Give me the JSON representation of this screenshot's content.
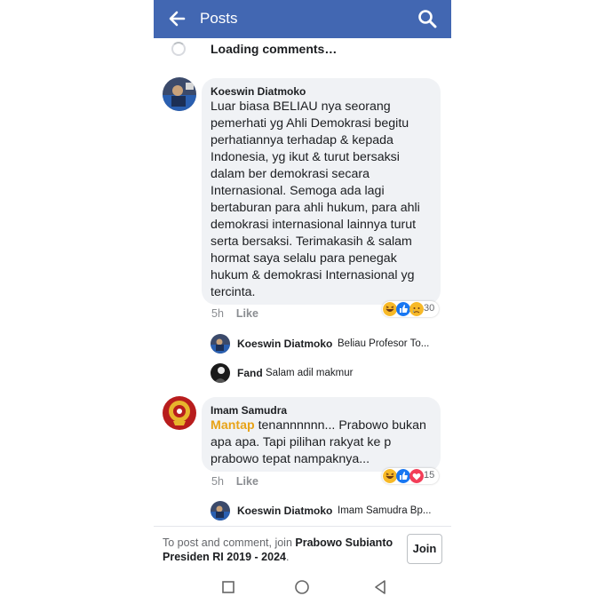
{
  "header": {
    "title": "Posts",
    "back_icon": "back-arrow-icon",
    "search_icon": "search-icon",
    "color": "#4267b2"
  },
  "loading": {
    "text": "Loading comments…"
  },
  "comments": [
    {
      "author": "Koeswin Diatmoko",
      "lines": [
        "Luar biasa BELIAU nya seorang",
        "pemerhati yg  Ahli Demokrasi begitu",
        "perhatiannya terhadap & kepada",
        "Indonesia, yg ikut & turut bersaksi",
        "dalam ber demokrasi secara",
        "Internasional. Semoga ada lagi",
        "bertaburan para ahli hukum, para ahli",
        "demokrasi internasional lainnya turut",
        "serta bersaksi.  Terimakasih & salam",
        "hormat saya selalu para penegak",
        "hukum & demokrasi Internasional yg",
        "tercinta."
      ],
      "time": "5h",
      "like_label": "Like",
      "reaction_count": "30",
      "reactions": [
        "haha",
        "like",
        "sad"
      ],
      "replies": [
        {
          "author": "Koeswin Diatmoko",
          "text": "Beliau Profesor To..."
        },
        {
          "author": "Fand",
          "text": "Salam adil makmur"
        }
      ]
    },
    {
      "author": "Imam Samudra",
      "highlight": "Mantap",
      "lines": [
        " tenannnnnn... Prabowo bukan",
        "apa apa. Tapi pilihan rakyat ke p",
        "prabowo tepat nampaknya..."
      ],
      "time": "5h",
      "like_label": "Like",
      "reaction_count": "15",
      "reactions": [
        "haha",
        "like",
        "love"
      ],
      "replies": [
        {
          "author": "Koeswin Diatmoko",
          "text": "Imam Samudra Bp..."
        }
      ]
    }
  ],
  "join_bar": {
    "prefix": "To post and comment, join ",
    "group": "Prabowo Subianto Presiden RI 2019 - 2024",
    "suffix": ".",
    "button": "Join"
  },
  "nav": {
    "items": [
      "recent-apps-icon",
      "home-icon",
      "back-icon"
    ]
  },
  "colors": {
    "highlight": "#e8a317",
    "reaction_like": "#1877f2",
    "reaction_love": "#f33e58",
    "reaction_haha": "#f7b928"
  }
}
